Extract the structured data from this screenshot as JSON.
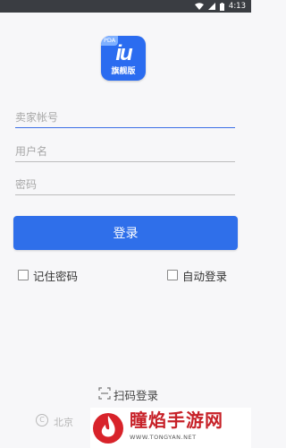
{
  "status_bar": {
    "time": "4:13"
  },
  "logo": {
    "badge": "PDA",
    "mark": "iu",
    "subtitle": "旗舰版"
  },
  "form": {
    "seller_account_placeholder": "卖家帐号",
    "username_placeholder": "用户名",
    "password_placeholder": "密码",
    "login_label": "登录",
    "remember_password_label": "记住密码",
    "auto_login_label": "自动登录"
  },
  "scan_login_label": "扫码登录",
  "footer": {
    "copyright_symbol": "C",
    "copyright_text": "北京"
  },
  "watermark": {
    "title": "瞳焰手游网",
    "url": "WWW.TONGYAN.NET"
  },
  "colors": {
    "primary": "#2f6fea",
    "status_bar": "#3a3d42",
    "watermark": "#c72128"
  }
}
